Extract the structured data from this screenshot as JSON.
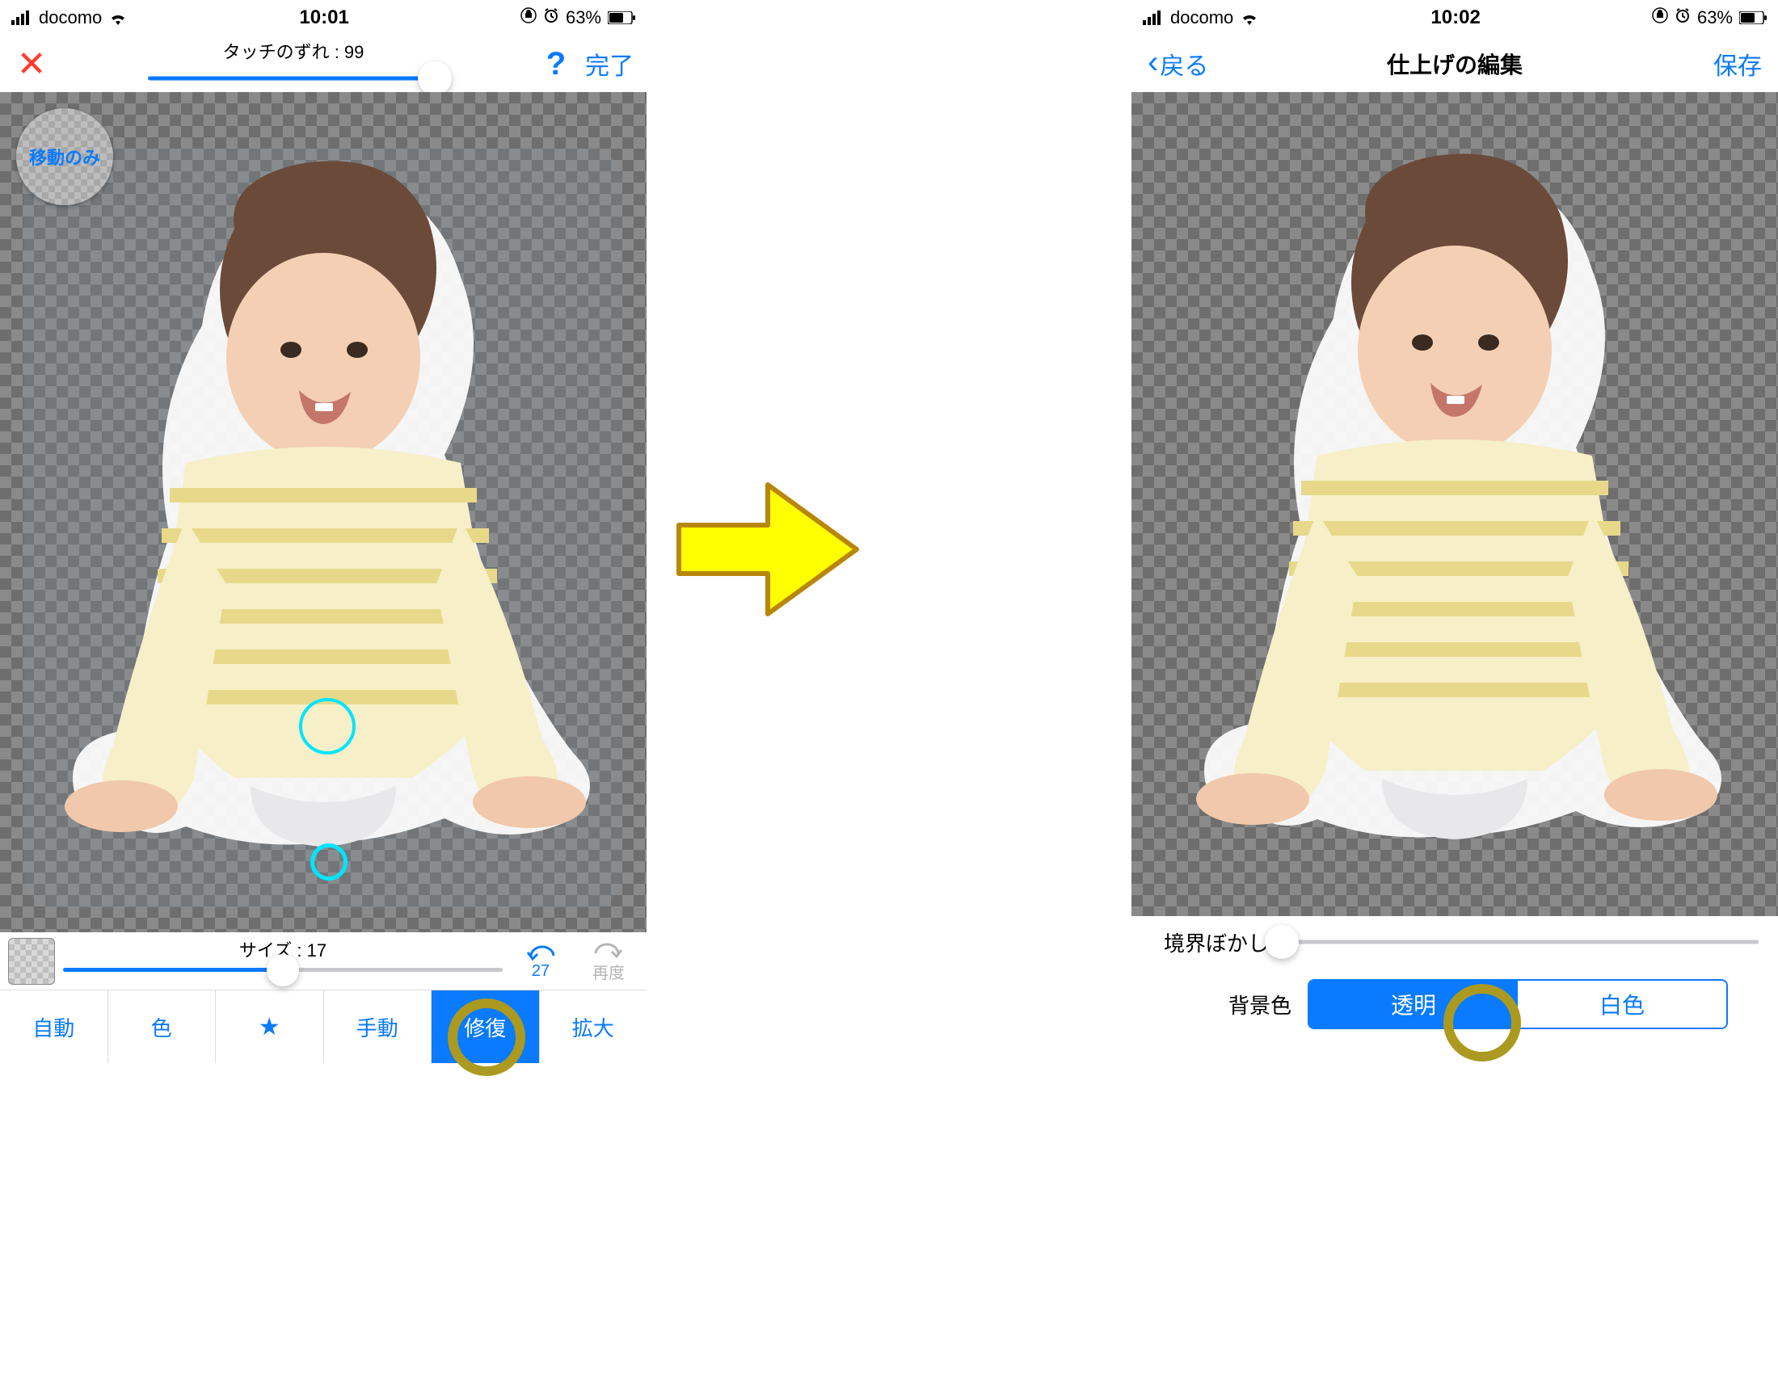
{
  "left": {
    "status": {
      "carrier": "docomo",
      "time": "10:01",
      "battery_pct": "63%"
    },
    "topbar": {
      "touch_offset_label": "タッチのずれ : 99",
      "done": "完了"
    },
    "move_only_badge": "移動のみ",
    "size": {
      "label": "サイズ : 17",
      "undo_count": "27",
      "redo_label": "再度"
    },
    "tabs": [
      "自動",
      "色",
      "★",
      "手動",
      "修復",
      "拡大"
    ],
    "active_tab_index": 4
  },
  "right": {
    "status": {
      "carrier": "docomo",
      "time": "10:02",
      "battery_pct": "63%"
    },
    "topbar": {
      "back": "戻る",
      "title": "仕上げの編集",
      "save": "保存"
    },
    "blur_label": "境界ぼかし",
    "bg_label": "背景色",
    "segments": [
      "透明",
      "白色"
    ],
    "selected_segment_index": 0
  }
}
